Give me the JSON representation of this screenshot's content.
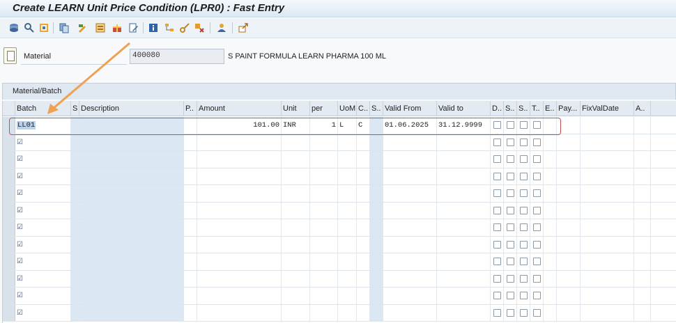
{
  "window": {
    "title": "Create LEARN Unit Price Condition (LPR0) : Fast Entry"
  },
  "toolbar": {
    "icons": [
      "save-icon",
      "find-icon",
      "other-icon",
      "copy-icon",
      "change-icon",
      "new-icon",
      "gift-icon",
      "edit-icon",
      "info-icon",
      "structure-icon",
      "key-icon",
      "cut-icon",
      "people-icon",
      "export-icon"
    ]
  },
  "material": {
    "label": "Material",
    "value": "400080",
    "description": "S PAINT FORMULA LEARN PHARMA 100 ML"
  },
  "tab": {
    "label": "Material/Batch"
  },
  "columns": [
    "Batch",
    "S",
    "Description",
    "P..",
    "Amount",
    "Unit",
    "per",
    "UoM",
    "C..",
    "S..",
    "Valid From",
    "Valid to",
    "D..",
    "S..",
    "S..",
    "T..",
    "E..",
    "Pay...",
    "FixValDate",
    "A.."
  ],
  "first_row": {
    "batch": "LL01",
    "amount": "101.00",
    "unit": "INR",
    "per": "1",
    "uom": "L",
    "c": "C",
    "valid_from": "01.06.2025",
    "valid_to": "31.12.9999"
  },
  "empty_row_marker": "☑",
  "colors": {
    "highlight_box": "#c0504d",
    "arrow": "#f0a050"
  }
}
